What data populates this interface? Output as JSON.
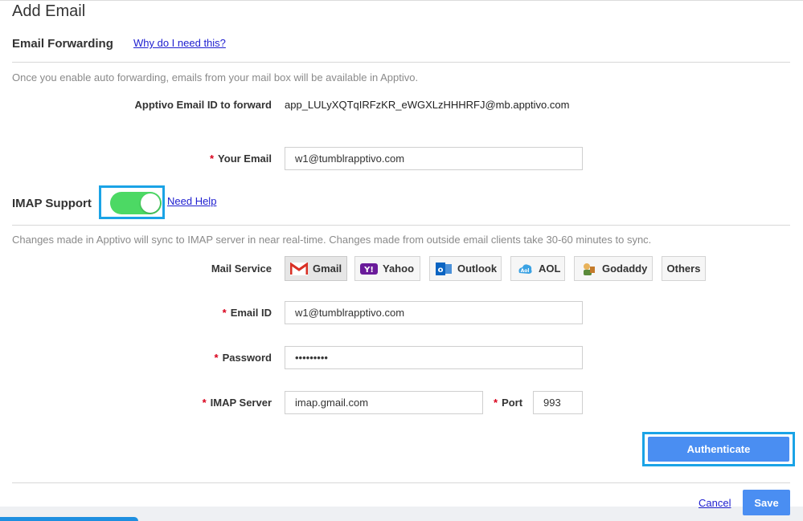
{
  "page_title": "Add Email",
  "forwarding": {
    "section_title": "Email Forwarding",
    "help_link": "Why do I need this?",
    "description": "Once you enable auto forwarding, emails from your mail box will be available in Apptivo.",
    "forward_label": "Apptivo Email ID to forward",
    "forward_value": "app_LULyXQTqIRFzKR_eWGXLzHHHRFJ@mb.apptivo.com",
    "your_email_label": "Your Email",
    "your_email_value": "w1@tumblrapptivo.com"
  },
  "imap": {
    "section_title": "IMAP Support",
    "toggle_on": true,
    "help_link": "Need Help",
    "description": "Changes made in Apptivo will sync to IMAP server in near real-time. Changes made from outside email clients take 30-60 minutes to sync.",
    "mail_service_label": "Mail Service",
    "services": [
      "Gmail",
      "Yahoo",
      "Outlook",
      "AOL",
      "Godaddy",
      "Others"
    ],
    "selected_service": "Gmail",
    "email_id_label": "Email ID",
    "email_id_value": "w1@tumblrapptivo.com",
    "password_label": "Password",
    "password_value": "•••••••••",
    "imap_server_label": "IMAP Server",
    "imap_server_value": "imap.gmail.com",
    "port_label": "Port",
    "port_value": "993",
    "required_mark": "*"
  },
  "actions": {
    "authenticate_label": "Authenticate",
    "cancel_label": "Cancel",
    "save_label": "Save"
  },
  "colors": {
    "primary": "#4a8ef2",
    "highlight": "#1aa3e6",
    "toggle_on": "#4cd964",
    "required": "#d9001b"
  }
}
